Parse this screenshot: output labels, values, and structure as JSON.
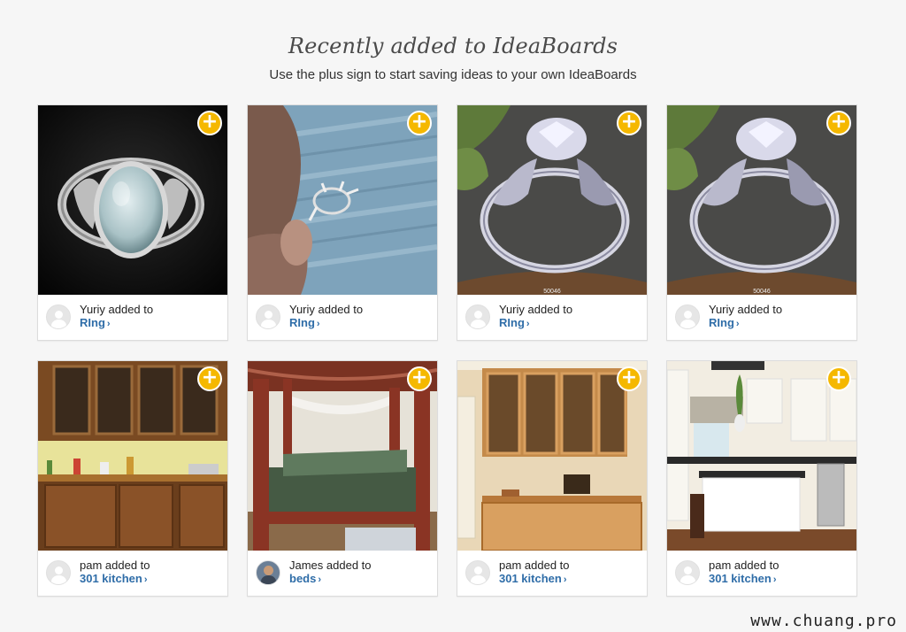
{
  "header": {
    "title": "Recently added to IdeaBoards",
    "subtitle": "Use the plus sign to start saving ideas to your own IdeaBoards"
  },
  "colors": {
    "plus": "#f5b800",
    "link": "#2f6da8"
  },
  "cards": [
    {
      "user": "Yuriy added to",
      "board": "RIng",
      "image": "jade-ring-photo",
      "avatar": "default-avatar"
    },
    {
      "user": "Yuriy added to",
      "board": "RIng",
      "image": "ring-setting-photo",
      "avatar": "default-avatar"
    },
    {
      "user": "Yuriy added to",
      "board": "RIng",
      "image": "diamond-ring-photo",
      "avatar": "default-avatar",
      "caption": "50046"
    },
    {
      "user": "Yuriy added to",
      "board": "RIng",
      "image": "diamond-ring-photo",
      "avatar": "default-avatar",
      "caption": "50046"
    },
    {
      "user": "pam added to",
      "board": "301 kitchen",
      "image": "wood-cabinets-photo",
      "avatar": "default-avatar"
    },
    {
      "user": "James added to",
      "board": "beds",
      "image": "canopy-bed-photo",
      "avatar": "user-photo-avatar"
    },
    {
      "user": "pam added to",
      "board": "301 kitchen",
      "image": "glass-cabinet-photo",
      "avatar": "default-avatar"
    },
    {
      "user": "pam added to",
      "board": "301 kitchen",
      "image": "kitchen-island-photo",
      "avatar": "default-avatar"
    }
  ],
  "plus_symbol": "+",
  "chevron": "›",
  "watermark": "www.chuang.pro"
}
